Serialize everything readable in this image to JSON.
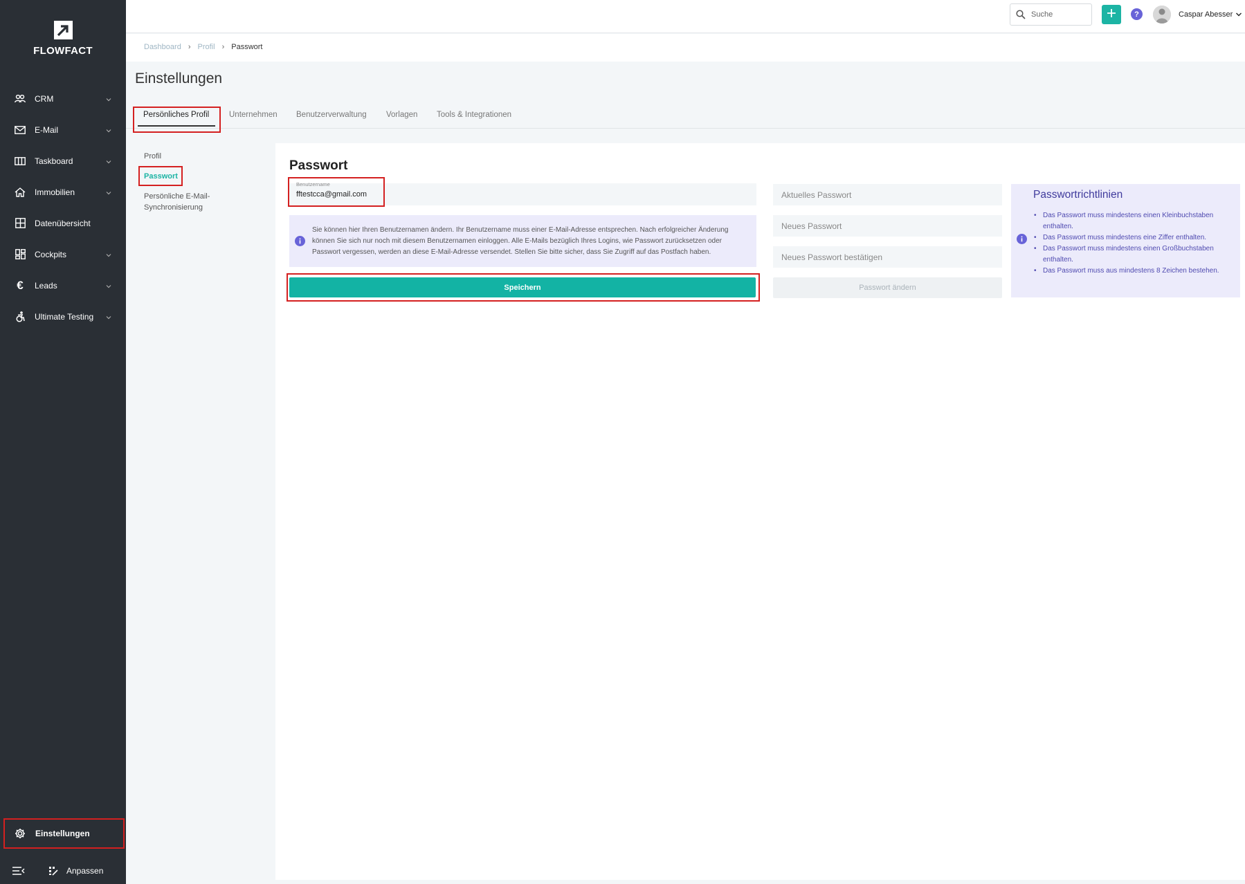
{
  "sidebar": {
    "brand": "FLOWFACT",
    "items": [
      {
        "label": "CRM",
        "icon": "people-icon"
      },
      {
        "label": "E-Mail",
        "icon": "envelope-icon"
      },
      {
        "label": "Taskboard",
        "icon": "board-icon"
      },
      {
        "label": "Immobilien",
        "icon": "house-icon"
      },
      {
        "label": "Datenübersicht",
        "icon": "grid-icon"
      },
      {
        "label": "Cockpits",
        "icon": "dashboard-icon"
      },
      {
        "label": "Leads",
        "icon": "euro-icon"
      },
      {
        "label": "Ultimate Testing",
        "icon": "accessibility-icon"
      }
    ],
    "settings_label": "Einstellungen",
    "customize_label": "Anpassen"
  },
  "header": {
    "search_placeholder": "Suche",
    "user_name": "Caspar Abesser"
  },
  "breadcrumb": {
    "items": [
      "Dashboard",
      "Profil",
      "Passwort"
    ]
  },
  "page": {
    "title": "Einstellungen",
    "tabs": [
      "Persönliches Profil",
      "Unternehmen",
      "Benutzerverwaltung",
      "Vorlagen",
      "Tools & Integrationen"
    ],
    "active_tab": "Persönliches Profil"
  },
  "subnav": {
    "items": [
      "Profil",
      "Passwort",
      "Persönliche E-Mail-Synchronisierung"
    ],
    "active": "Passwort"
  },
  "form": {
    "title": "Passwort",
    "username_label": "Benutzername",
    "username_value": "fftestcca@gmail.com",
    "info_text": "Sie können hier Ihren Benutzernamen ändern. Ihr Benutzername muss einer E-Mail-Adresse entsprechen. Nach erfolgreicher Änderung können Sie sich nur noch mit diesem Benutzernamen einloggen. Alle E-Mails bezüglich Ihres Logins, wie Passwort zurücksetzen oder Passwort vergessen, werden an diese E-Mail-Adresse versendet. Stellen Sie bitte sicher, dass Sie Zugriff auf das Postfach haben.",
    "save_label": "Speichern",
    "current_password_placeholder": "Aktuelles Passwort",
    "new_password_placeholder": "Neues Passwort",
    "confirm_password_placeholder": "Neues Passwort bestätigen",
    "change_password_label": "Passwort ändern"
  },
  "rules": {
    "title": "Passwortrichtlinien",
    "items": [
      "Das Passwort muss mindestens einen Kleinbuchstaben enthalten.",
      "Das Passwort muss mindestens eine Ziffer enthalten.",
      "Das Passwort muss mindestens einen Großbuchstaben enthalten.",
      "Das Passwort muss aus mindestens 8 Zeichen bestehen."
    ]
  },
  "colors": {
    "sidebar_bg": "#2a2f35",
    "accent": "#13b3a4",
    "highlight": "#d42020",
    "info_bg": "#ecebfb",
    "info_text": "#4f4ab0"
  }
}
